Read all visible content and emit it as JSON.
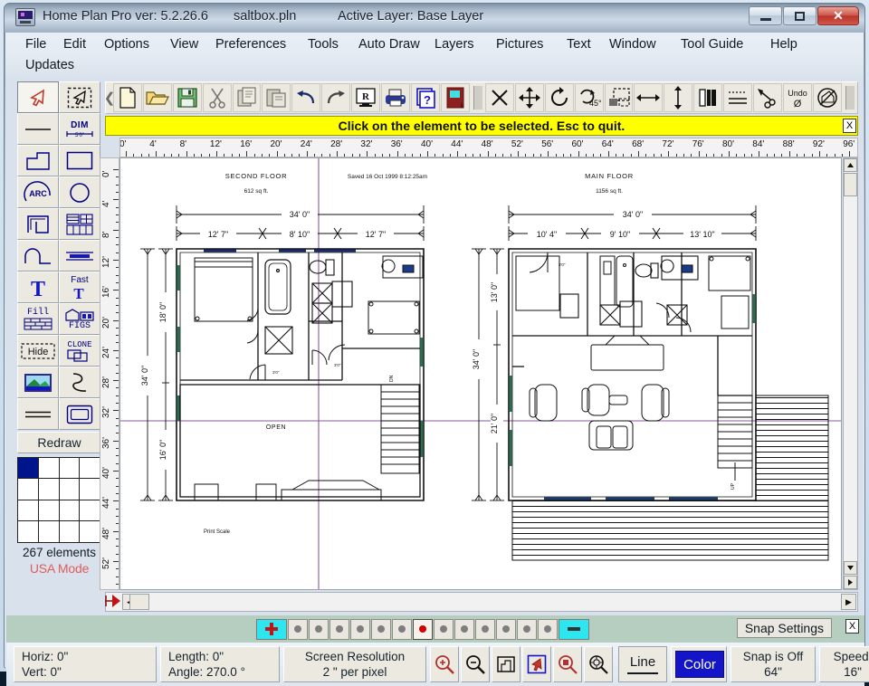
{
  "window": {
    "title": "Home Plan Pro ver: 5.2.26.6",
    "filename": "saltbox.pln",
    "active_layer": "Active Layer: Base Layer",
    "minimize_label": "Minimize",
    "maximize_label": "Maximize",
    "close_label": "✕"
  },
  "menu": {
    "row1": [
      "File",
      "Edit",
      "Options",
      "View",
      "Preferences",
      "Tools",
      "Auto Draw",
      "Layers",
      "Pictures",
      "Text",
      "Window",
      "Tool Guide",
      "Help"
    ],
    "row2": [
      "Updates"
    ]
  },
  "prompt": {
    "message": "Click on the element to be selected.  Esc to quit.",
    "close_label": "X"
  },
  "left_toolbar": {
    "buttons": [
      {
        "name": "select-arrow-tool",
        "icon": "arrow-cursor-icon",
        "label": ""
      },
      {
        "name": "select-group-tool",
        "icon": "marquee-cursor-icon",
        "label": ""
      },
      {
        "name": "line-tool",
        "icon": "line-icon",
        "label": ""
      },
      {
        "name": "dimension-tool",
        "icon": "dim-icon",
        "label": "DIM"
      },
      {
        "name": "polyline-tool",
        "icon": "polygon-icon",
        "label": ""
      },
      {
        "name": "rectangle-tool",
        "icon": "rectangle-icon",
        "label": ""
      },
      {
        "name": "arc-tool",
        "icon": "arc-icon",
        "label": "ARC"
      },
      {
        "name": "circle-tool",
        "icon": "circle-icon",
        "label": ""
      },
      {
        "name": "wall-tool",
        "icon": "wall-corner-icon",
        "label": ""
      },
      {
        "name": "window-tool",
        "icon": "window-grid-icon",
        "label": ""
      },
      {
        "name": "curve-tool",
        "icon": "bump-curve-icon",
        "label": ""
      },
      {
        "name": "beam-tool",
        "icon": "beam-icon",
        "label": ""
      },
      {
        "name": "text-tool",
        "icon": "text-T-icon",
        "label": "T"
      },
      {
        "name": "fast-text-tool",
        "icon": "fast-text-icon",
        "label": "Fast"
      },
      {
        "name": "fill-tool",
        "icon": "fill-brick-icon",
        "label": "Fill"
      },
      {
        "name": "figures-tool",
        "icon": "figs-icon",
        "label": "FIGS"
      },
      {
        "name": "hide-tool",
        "icon": "hide-icon",
        "label": "Hide"
      },
      {
        "name": "clone-tool",
        "icon": "clone-icon",
        "label": "CLONE"
      },
      {
        "name": "picture-tool",
        "icon": "landscape-picture-icon",
        "label": ""
      },
      {
        "name": "freehand-tool",
        "icon": "squiggle-icon",
        "label": ""
      },
      {
        "name": "double-line-tool",
        "icon": "double-line-icon",
        "label": ""
      },
      {
        "name": "box-tool",
        "icon": "rounded-box-icon",
        "label": ""
      }
    ],
    "redraw_label": "Redraw",
    "elements_count": "267 elements",
    "mode": "USA Mode",
    "palette_active_color": "#00148c"
  },
  "top_toolbar": {
    "buttons": [
      {
        "name": "new-file-button",
        "icon": "page-icon"
      },
      {
        "name": "open-file-button",
        "icon": "folder-open-icon"
      },
      {
        "name": "save-file-button",
        "icon": "floppy-disk-icon"
      },
      {
        "name": "cut-button",
        "icon": "scissors-icon"
      },
      {
        "name": "copy-button",
        "icon": "copy-icon"
      },
      {
        "name": "paste-button",
        "icon": "paste-icon"
      },
      {
        "name": "undo-button",
        "icon": "undo-arrow-icon"
      },
      {
        "name": "redo-button",
        "icon": "redo-arrow-icon"
      },
      {
        "name": "print-preview-button",
        "icon": "monitor-R-icon"
      },
      {
        "name": "print-button",
        "icon": "printer-icon"
      },
      {
        "name": "help-button",
        "icon": "question-page-icon"
      },
      {
        "name": "door-button",
        "icon": "red-door-icon"
      },
      {
        "name": "delete-button",
        "icon": "x-delete-icon"
      },
      {
        "name": "move-button",
        "icon": "move-cross-icon"
      },
      {
        "name": "rotate-button",
        "icon": "rotate-icon"
      },
      {
        "name": "rotate-45-button",
        "icon": "rotate-45-icon"
      },
      {
        "name": "copy-region-button",
        "icon": "dashed-region-icon"
      },
      {
        "name": "stretch-horizontal-button",
        "icon": "horizontal-arrows-icon"
      },
      {
        "name": "stretch-vertical-button",
        "icon": "vertical-arrows-icon"
      },
      {
        "name": "mirror-button",
        "icon": "mirror-bars-icon"
      },
      {
        "name": "align-button",
        "icon": "align-lines-icon"
      },
      {
        "name": "attribute-button",
        "icon": "paint-attribute-icon"
      },
      {
        "name": "undo-zero-button",
        "icon": "undo-zero-icon"
      },
      {
        "name": "cancel-tool-button",
        "icon": "no-entry-icon"
      }
    ]
  },
  "rulers": {
    "horizontal_unit": "'",
    "horizontal_ticks": [
      "0'",
      "4'",
      "8'",
      "12'",
      "16'",
      "20'",
      "24'",
      "28'",
      "32'",
      "36'",
      "40'",
      "44'",
      "48'",
      "52'",
      "56'",
      "60'",
      "64'",
      "68'",
      "72'",
      "76'",
      "80'",
      "84'",
      "88'",
      "92'",
      "96'"
    ],
    "vertical_ticks": [
      "0'",
      "4'",
      "8'",
      "12'",
      "16'",
      "20'",
      "24'",
      "28'",
      "32'",
      "36'",
      "40'",
      "44'",
      "48'",
      "52'"
    ]
  },
  "drawing": {
    "saved_note": "Saved 16 Oct 1999  8:12:25am",
    "print_scale_label": "Print Scale",
    "second_floor": {
      "title": "SECOND FLOOR",
      "area": "612 sq ft.",
      "width_total": "34' 0\"",
      "width_parts": [
        "12' 7\"",
        "8' 10\"",
        "12' 7\""
      ],
      "height_total": "34' 0\"",
      "height_parts": [
        "18' 0\"",
        "16' 0\""
      ],
      "open_label": "OPEN"
    },
    "main_floor": {
      "title": "MAIN FLOOR",
      "area": "1156 sq ft.",
      "width_total": "34' 0\"",
      "width_parts": [
        "10' 4\"",
        "9' 10\"",
        "13' 10\""
      ],
      "height_total": "34' 0\"",
      "height_parts": [
        "13' 0\"",
        "21' 0\""
      ],
      "up_label": "UP"
    }
  },
  "snapbar": {
    "plus_label": "+",
    "minus_label": "−",
    "dot_count_left": 6,
    "dot_count_right": 6,
    "active_dot_color": "#d40000",
    "snap_settings_label": "Snap Settings",
    "close_label": "X"
  },
  "statusbar": {
    "coords": {
      "horiz": "Horiz: 0\"",
      "vert": "Vert:  0\""
    },
    "measure": {
      "length": "Length:  0\"",
      "angle": "Angle:  270.0 °"
    },
    "resolution": {
      "title": "Screen Resolution",
      "value": "2 \" per pixel"
    },
    "zoom_buttons": [
      {
        "name": "zoom-in-button",
        "icon": "magnifier-plus-icon"
      },
      {
        "name": "zoom-out-button",
        "icon": "magnifier-minus-icon"
      },
      {
        "name": "zoom-fit-button",
        "icon": "zoom-fit-icon"
      },
      {
        "name": "zoom-select-button",
        "icon": "zoom-arrow-icon"
      },
      {
        "name": "zoom-window-button",
        "icon": "zoom-window-icon"
      },
      {
        "name": "zoom-previous-button",
        "icon": "zoom-previous-icon"
      }
    ],
    "line_label": "Line",
    "color_label": "Color",
    "color_value": "#1414c8",
    "snap": {
      "title": "Snap is Off",
      "value": "64\""
    },
    "speed": {
      "title": "Speed:",
      "value": "16\"",
      "minus": "-",
      "plus": "+"
    }
  }
}
